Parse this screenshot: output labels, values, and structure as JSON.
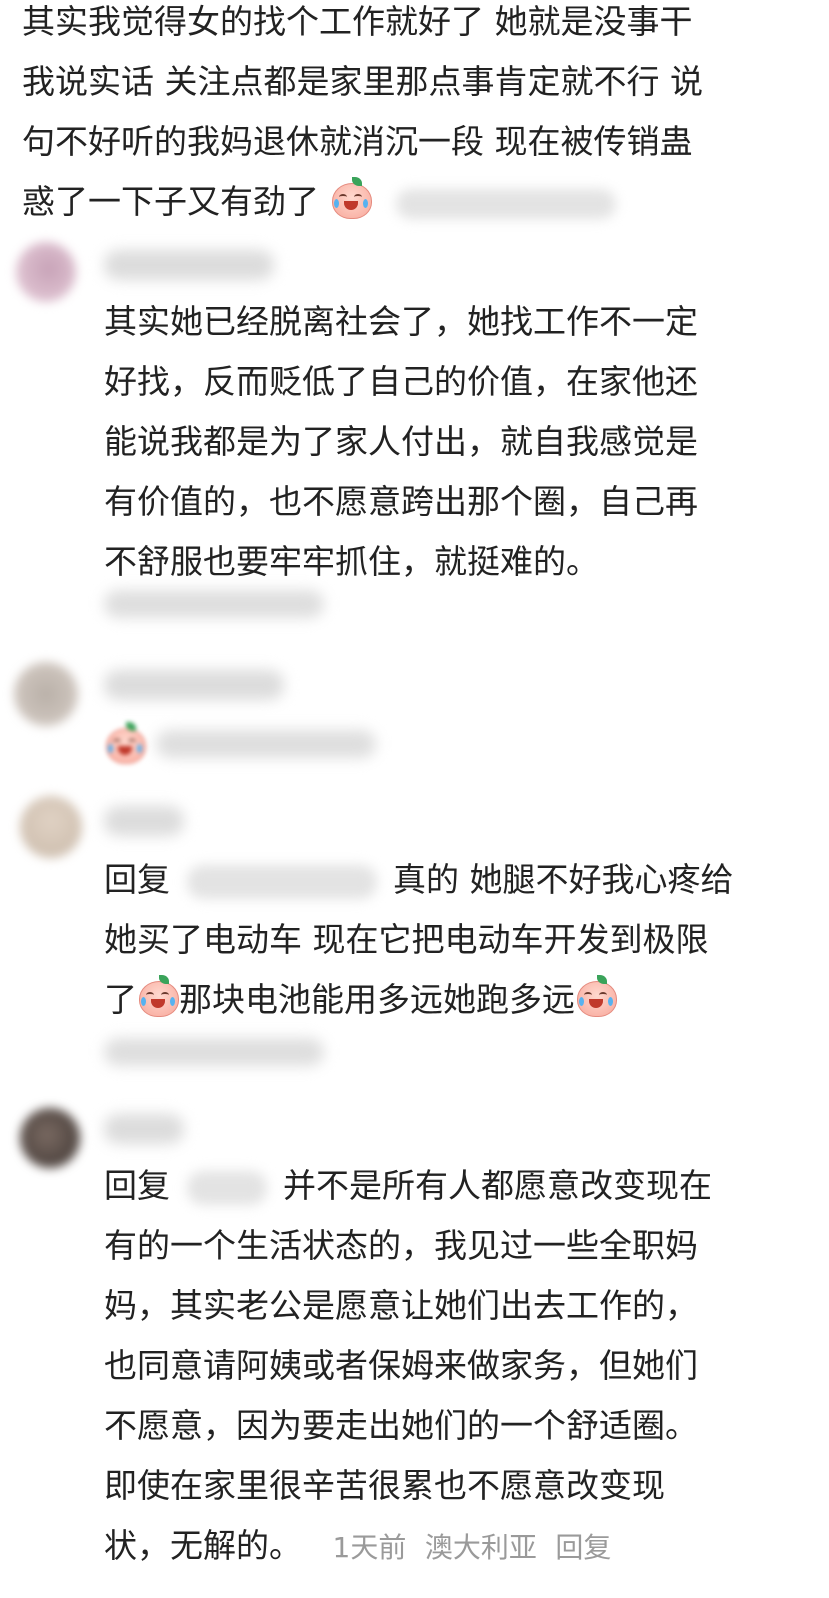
{
  "colors": {
    "text": "#222222",
    "meta": "#9a9a9a",
    "emoji_face": "#f8a79a",
    "emoji_leaf": "#3aa35a"
  },
  "emoji": "crying-laughing-face-icon",
  "comment1": {
    "lines": [
      "其实我觉得女的找个工作就好了 她就是没事干",
      "我说实话 关注点都是家里那点事肯定就不行 说",
      "句不好听的我妈退休就消沉一段 现在被传销蛊",
      "惑了一下子又有劲了"
    ]
  },
  "reply1": {
    "lines": [
      "其实她已经脱离社会了，她找工作不一定",
      "好找，反而贬低了自己的价值，在家他还",
      "能说我都是为了家人付出，就自我感觉是",
      "有价值的，也不愿意跨出那个圈，自己再",
      "不舒服也要牢牢抓住，就挺难的。"
    ]
  },
  "reply3": {
    "prefix": "回复",
    "line1_after": "真的 她腿不好我心疼给",
    "line2": "她买了电动车 现在它把电动车开发到极限",
    "line3_a": "了",
    "line3_b": "那块电池能用多远她跑多远"
  },
  "reply4": {
    "prefix": "回复",
    "line1_after": "并不是所有人都愿意改变现在",
    "lines": [
      "有的一个生活状态的，我见过一些全职妈",
      "妈，其实老公是愿意让她们出去工作的，",
      "也同意请阿姨或者保姆来做家务，但她们",
      "不愿意，因为要走出她们的一个舒适圈。",
      "即使在家里很辛苦很累也不愿意改变现"
    ],
    "last_text": "状，无解的。",
    "time": "1天前",
    "location": "澳大利亚",
    "reply_label": "回复"
  }
}
